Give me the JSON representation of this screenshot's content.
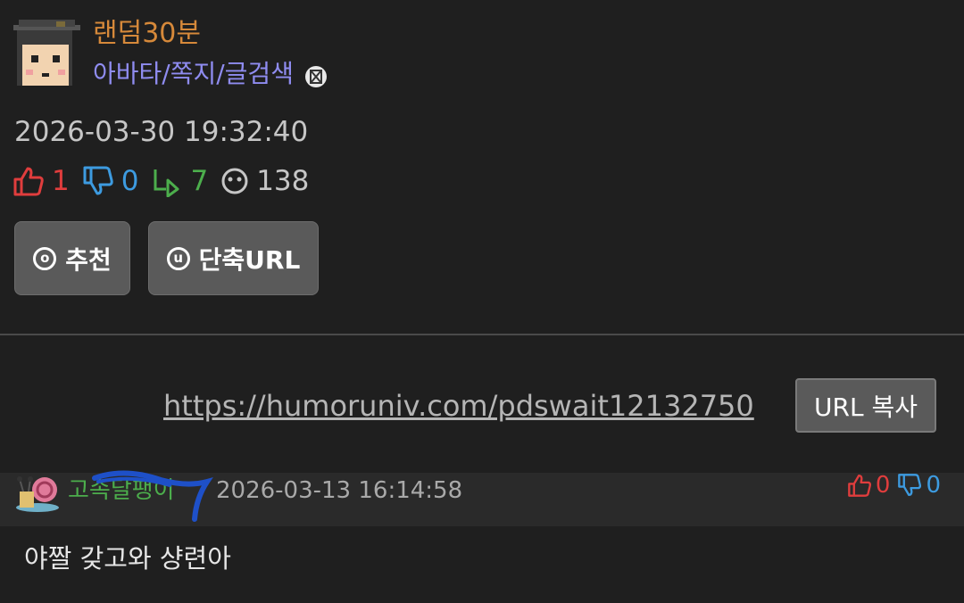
{
  "author": {
    "nickname": "랜덤30분",
    "links_label": "아바타/쪽지/글검색",
    "blocked_icon": "block-icon"
  },
  "post": {
    "date": "2026-03-30 19:32:40",
    "stats": {
      "recommend": "1",
      "dislike": "0",
      "replies": "7",
      "views": "138"
    }
  },
  "buttons": {
    "recommend_icon_char": "o",
    "recommend_label": "추천",
    "shorturl_icon_char": "u",
    "shorturl_label": "단축URL"
  },
  "short_url": {
    "url": "https://humoruniv.com/pdswait12132750",
    "copy_label": "URL 복사"
  },
  "comment": {
    "author": "고속달팽이",
    "date": "2026-03-13 16:14:58",
    "up": "0",
    "down": "0",
    "text": "야짤 갖고와 샹련아"
  },
  "colors": {
    "background": "#1f1f1f",
    "nickname": "#d6893a",
    "links": "#8f8cf0",
    "up": "#e03d3d",
    "down": "#3d9be0",
    "reply": "#4cae4c",
    "button_bg": "#5a5a5a"
  }
}
